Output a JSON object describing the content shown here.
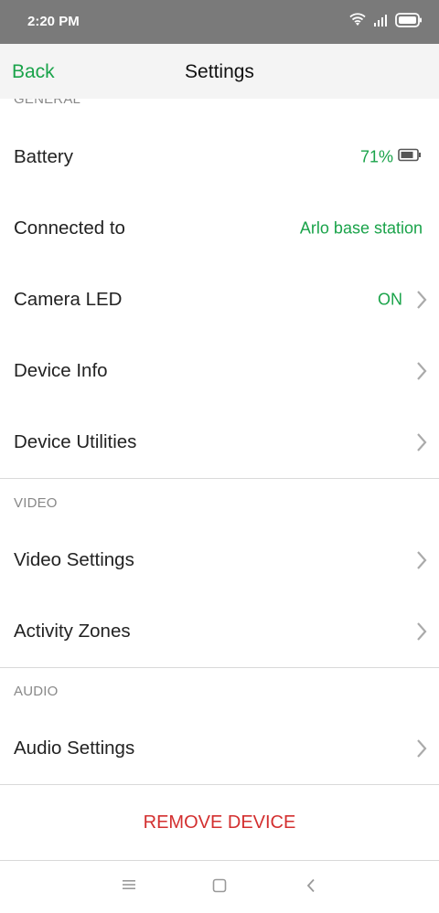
{
  "status_bar": {
    "time": "2:20 PM",
    "icons": [
      "wifi-icon",
      "signal-icon",
      "battery-icon"
    ]
  },
  "header": {
    "back_label": "Back",
    "title": "Settings"
  },
  "sections": {
    "general": {
      "title": "GENERAL",
      "battery": {
        "label": "Battery",
        "value": "71%",
        "icon": "battery-icon"
      },
      "connected": {
        "label": "Connected to",
        "value": "Arlo base station"
      },
      "camera_led": {
        "label": "Camera LED",
        "value": "ON"
      },
      "device_info": {
        "label": "Device Info"
      },
      "device_utilities": {
        "label": "Device Utilities"
      }
    },
    "video": {
      "title": "VIDEO",
      "video_settings": {
        "label": "Video Settings"
      },
      "activity_zones": {
        "label": "Activity Zones"
      }
    },
    "audio": {
      "title": "AUDIO",
      "audio_settings": {
        "label": "Audio Settings"
      }
    }
  },
  "remove_device_label": "REMOVE DEVICE",
  "system_nav": [
    "menu-icon",
    "home-icon",
    "back-icon"
  ],
  "colors": {
    "accent": "#1aa34a",
    "danger": "#d32f2f",
    "status_bar": "#7a7a7a",
    "nav_bar": "#f4f4f4"
  }
}
